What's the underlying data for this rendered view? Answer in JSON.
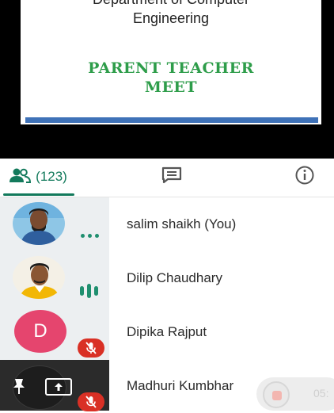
{
  "slide": {
    "department_line": "Department of Computer",
    "engineering_line": "Engineering",
    "title_line1": "PARENT TEACHER",
    "title_line2": "MEET",
    "title_color": "#2e9d4a",
    "bar_color": "#3f72b8"
  },
  "tabs": {
    "people_count": "(123)",
    "active_tab": "people",
    "accent_color": "#137a5c",
    "people_icon": "people-icon",
    "chat_icon": "chat-icon",
    "info_icon": "info-icon"
  },
  "participants": [
    {
      "name": "salim shaikh (You)",
      "avatar": "photo",
      "status": "more-options-icon"
    },
    {
      "name": "Dilip Chaudhary",
      "avatar": "photo",
      "status": "audio-level-icon"
    },
    {
      "name": "Dipika Rajput",
      "avatar": "D",
      "status": "mic-off-icon"
    },
    {
      "name": "Madhuri Kumbhar",
      "avatar": "dark",
      "status": "mic-off-icon",
      "tile_icons": [
        "pin-icon",
        "present-screen-icon"
      ]
    }
  ],
  "recording": {
    "time": "05:"
  }
}
